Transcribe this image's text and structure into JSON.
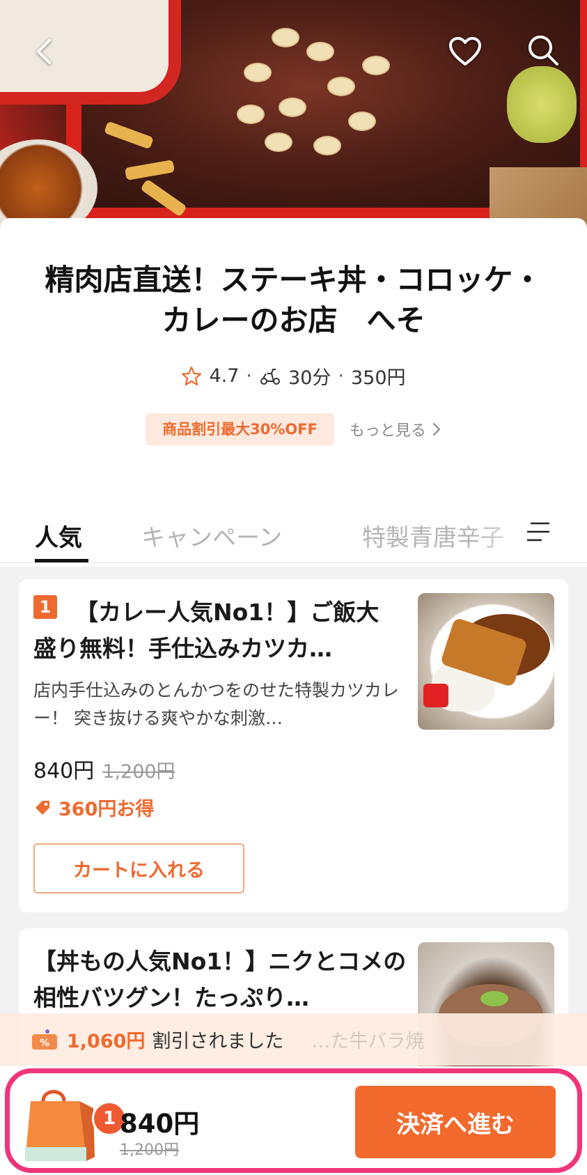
{
  "store": {
    "name": "精肉店直送！ステーキ丼・コロッケ・カレーのお店　へそ",
    "rating": "4.7",
    "delivery_time": "30分",
    "delivery_fee": "350円",
    "promo_badge": "商品割引最大30%OFF",
    "more_link": "もっと見る"
  },
  "tabs": [
    {
      "label": "人気",
      "active": true
    },
    {
      "label": "キャンペーン",
      "active": false
    },
    {
      "label": "特製青唐辛子",
      "active": false
    }
  ],
  "items": [
    {
      "rank": "1",
      "title": "【カレー人気No1！】ご飯大盛り無料！手仕込みカツカ…",
      "description": "店内手仕込みのとんかつをのせた特製カツカレー！ 突き抜ける爽やかな刺激…",
      "price": "840円",
      "original_price": "1,200円",
      "saving": "360円お得",
      "add_to_cart": "カートに入れる"
    },
    {
      "title": "【丼もの人気No1！】ニクとコメの相性バツグン！たっぷり…",
      "description": "…た牛バラ焼"
    }
  ],
  "discount_banner": {
    "amount": "1,060円",
    "text": "割引されました"
  },
  "cart": {
    "count": "1",
    "total": "840円",
    "original_total": "1,200円",
    "checkout_label": "決済へ進む"
  },
  "colors": {
    "accent": "#ee6a2f",
    "checkout": "#f26a2e",
    "highlight": "#f0357a"
  }
}
